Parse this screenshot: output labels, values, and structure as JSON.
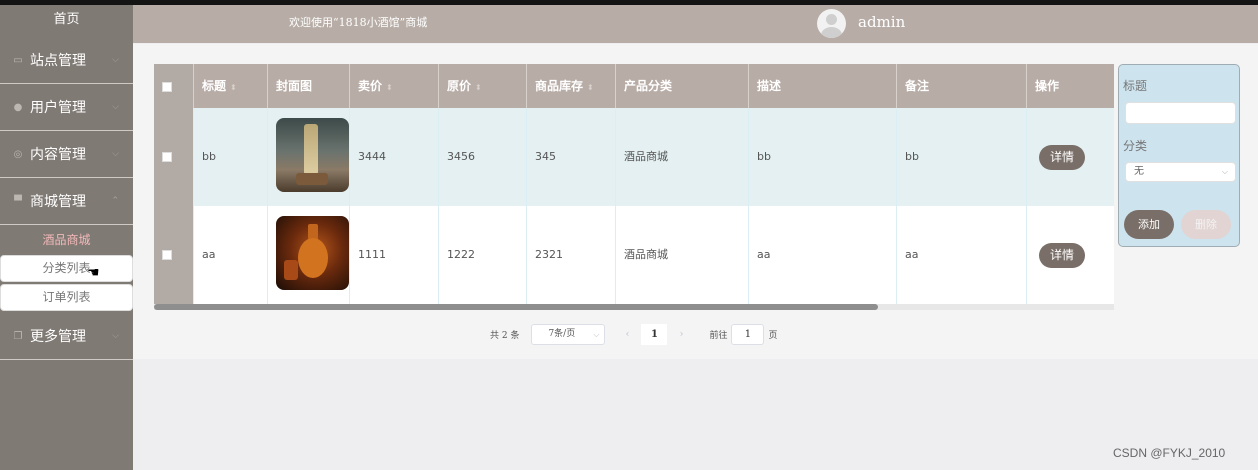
{
  "sidebar": {
    "home": "首页",
    "groups": [
      {
        "label": "站点管理",
        "icon": "monitor-icon"
      },
      {
        "label": "用户管理",
        "icon": "user-icon"
      },
      {
        "label": "内容管理",
        "icon": "gear-icon"
      },
      {
        "label": "商城管理",
        "icon": "store-icon"
      }
    ],
    "mall_subitems": [
      "酒品商城",
      "分类列表",
      "订单列表"
    ],
    "more": {
      "label": "更多管理",
      "icon": "copy-icon"
    }
  },
  "header": {
    "welcome": "欢迎使用“1818小酒馆”商城",
    "username": "admin"
  },
  "table": {
    "columns": [
      "标题",
      "封面图",
      "卖价",
      "原价",
      "商品库存",
      "产品分类",
      "描述",
      "备注",
      "操作"
    ],
    "rows": [
      {
        "title": "bb",
        "sell_price": "3444",
        "orig_price": "3456",
        "stock": "345",
        "category": "酒品商城",
        "desc": "bb",
        "remark": "bb",
        "action": "详情"
      },
      {
        "title": "aa",
        "sell_price": "1111",
        "orig_price": "1222",
        "stock": "2321",
        "category": "酒品商城",
        "desc": "aa",
        "remark": "aa",
        "action": "详情"
      }
    ]
  },
  "pagination": {
    "total": "共 2 条",
    "page_size": "7条/页",
    "current_page": "1",
    "goto_label": "前往",
    "goto_value": "1",
    "page_suffix": "页"
  },
  "search": {
    "title_label": "标题",
    "category_label": "分类",
    "category_value": "无",
    "add_label": "添加",
    "delete_label": "删除"
  },
  "watermark": "CSDN @FYKJ_2010",
  "colors": {
    "sidebar_bg": "#807a75",
    "header_bg": "#b7ada6",
    "table_header": "#b8aca6",
    "button": "#7a6f68",
    "panel_bg": "#cde3ee"
  }
}
